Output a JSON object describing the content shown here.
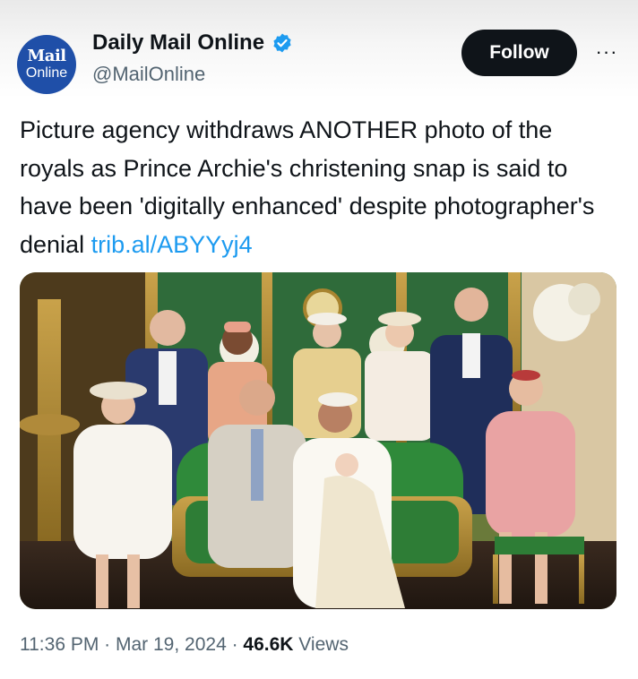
{
  "account": {
    "avatar_line1": "Mail",
    "avatar_line2": "Online",
    "display_name": "Daily Mail Online",
    "handle": "@MailOnline",
    "verified_icon": "verified-badge-icon"
  },
  "actions": {
    "follow_label": "Follow",
    "more_label": "···"
  },
  "tweet": {
    "text": "Picture agency withdraws ANOTHER photo of the royals as Prince Archie's christening snap is said to have been 'digitally enhanced' despite photographer's denial ",
    "link": "trib.al/ABYYyj4",
    "image_alt": "Royal family christening portrait"
  },
  "meta": {
    "time": "11:36 PM",
    "sep1": " · ",
    "date": "Mar 19, 2024",
    "sep2": " · ",
    "views_count": "46.6K",
    "views_label": " Views"
  },
  "colors": {
    "link": "#1d9bf0",
    "text": "#0f1419",
    "muted": "#536471",
    "avatar": "#1f4fa8"
  }
}
